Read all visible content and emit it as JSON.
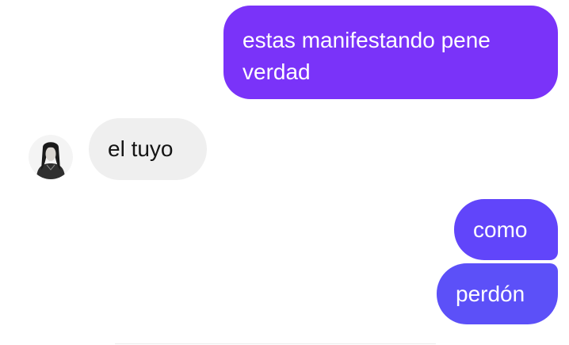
{
  "messages": [
    {
      "side": "sent",
      "text": "estas manifestando pene verdad"
    },
    {
      "side": "received",
      "text": "el tuyo"
    },
    {
      "side": "sent",
      "text": "como"
    },
    {
      "side": "sent",
      "text": "perdón"
    }
  ],
  "colors": {
    "sent_bubble_top": "#7a33f9",
    "sent_bubble_mid": "#6145fa",
    "sent_bubble_bottom": "#5c50f8",
    "received_bubble": "#efefef",
    "received_text": "#141414",
    "sent_text": "#ffffff"
  },
  "icons": {
    "avatar": "contact-avatar-icon"
  }
}
